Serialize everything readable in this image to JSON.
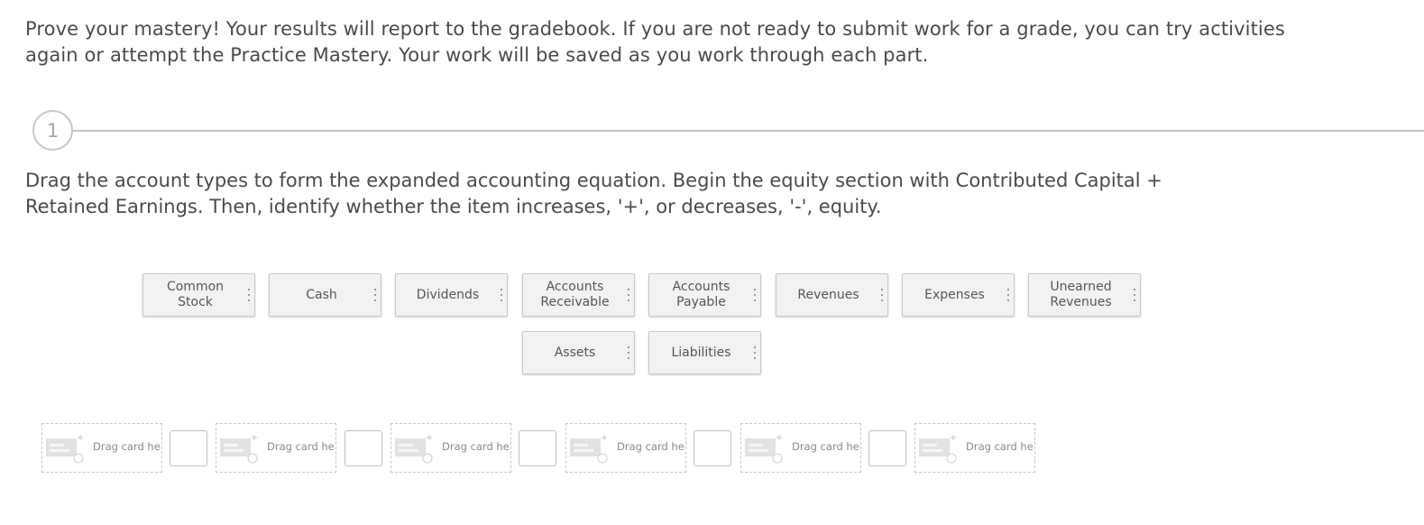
{
  "intro_text": "Prove your mastery! Your results will report to the gradebook. If you are not ready to submit work for a grade, you can try activities again or attempt the Practice Mastery. Your work will be saved as you work through each part.",
  "step": {
    "number": "1"
  },
  "instructions_text": "Drag the account types to form the expanded accounting equation. Begin the equity section with Contributed Capital + Retained Earnings. Then, identify whether the item increases, '+', or decreases, '-', equity.",
  "cards": [
    {
      "label": "Common Stock"
    },
    {
      "label": "Cash"
    },
    {
      "label": "Dividends"
    },
    {
      "label": "Accounts Receivable"
    },
    {
      "label": "Accounts Payable"
    },
    {
      "label": "Revenues"
    },
    {
      "label": "Expenses"
    },
    {
      "label": "Unearned Revenues"
    },
    {
      "label": "Assets"
    },
    {
      "label": "Liabilities"
    }
  ],
  "drop_zones": [
    {
      "label": "Drag card here"
    },
    {
      "label": "Drag card here"
    },
    {
      "label": "Drag card here"
    },
    {
      "label": "Drag card here"
    },
    {
      "label": "Drag card here"
    },
    {
      "label": "Drag card here"
    }
  ],
  "sign_inputs": [
    {
      "value": ""
    },
    {
      "value": ""
    },
    {
      "value": ""
    },
    {
      "value": ""
    },
    {
      "value": ""
    }
  ]
}
